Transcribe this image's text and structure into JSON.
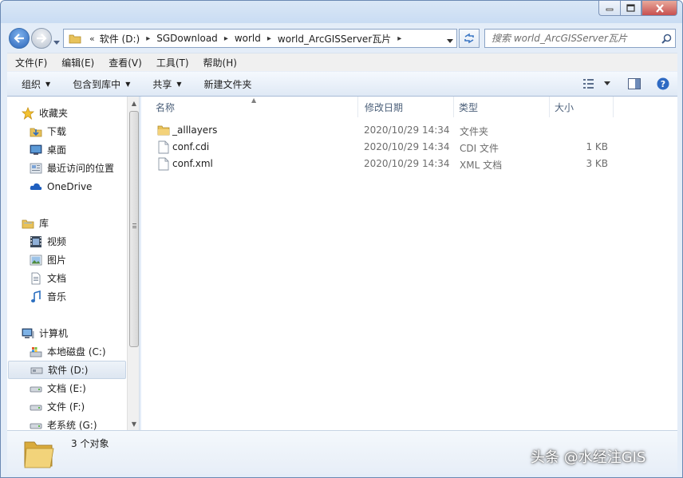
{
  "window": {
    "address_segments": [
      "软件 (D:)",
      "SGDownload",
      "world",
      "world_ArcGISServer瓦片"
    ],
    "address_overflow": "«",
    "search_placeholder": "搜索 world_ArcGISServer瓦片"
  },
  "menu": [
    "文件(F)",
    "编辑(E)",
    "查看(V)",
    "工具(T)",
    "帮助(H)"
  ],
  "toolbar": {
    "organize": "组织",
    "include_in_library": "包含到库中",
    "share": "共享",
    "new_folder": "新建文件夹"
  },
  "nav": {
    "favorites": {
      "label": "收藏夹",
      "items": [
        "下载",
        "桌面",
        "最近访问的位置",
        "OneDrive"
      ]
    },
    "libraries": {
      "label": "库",
      "items": [
        "视频",
        "图片",
        "文档",
        "音乐"
      ]
    },
    "computer": {
      "label": "计算机",
      "items": [
        "本地磁盘 (C:)",
        "软件 (D:)",
        "文档 (E:)",
        "文件 (F:)",
        "老系统 (G:)"
      ],
      "selected": "软件 (D:)"
    }
  },
  "columns": {
    "name": "名称",
    "date": "修改日期",
    "type": "类型",
    "size": "大小"
  },
  "files": [
    {
      "name": "_alllayers",
      "date": "2020/10/29 14:34",
      "type": "文件夹",
      "size": "",
      "icon": "folder-icon"
    },
    {
      "name": "conf.cdi",
      "date": "2020/10/29 14:34",
      "type": "CDI 文件",
      "size": "1 KB",
      "icon": "file-icon"
    },
    {
      "name": "conf.xml",
      "date": "2020/10/29 14:34",
      "type": "XML 文档",
      "size": "3 KB",
      "icon": "file-icon"
    }
  ],
  "details": {
    "count": "3 个对象"
  },
  "watermark": "头条 @水经注GIS",
  "colors": {
    "frame": "#e4edf8",
    "accent": "#2a64b8",
    "folder": "#e8c25a"
  }
}
